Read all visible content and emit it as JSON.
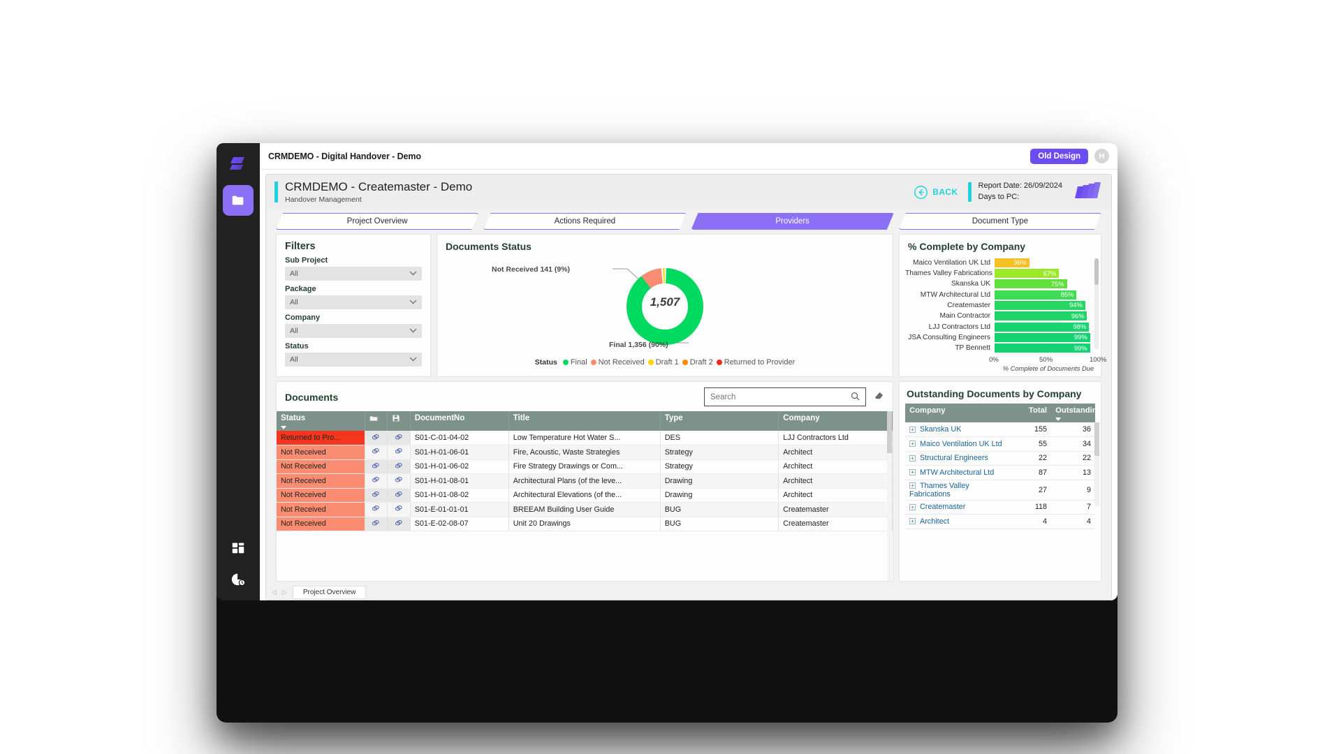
{
  "window": {
    "topbar_title": "CRMDEMO - Digital Handover - Demo",
    "old_design_label": "Old Design",
    "avatar_initial": "H"
  },
  "rail": {
    "logo_name": "layers-logo-icon",
    "items": [
      {
        "name": "folder-icon",
        "active": true
      },
      {
        "name": "dashboard-grid-icon",
        "active": false
      },
      {
        "name": "pie-clock-icon",
        "active": false
      }
    ]
  },
  "report": {
    "title": "CRMDEMO - Createmaster - Demo",
    "subtitle": "Handover Management",
    "back_label": "BACK",
    "report_date": "Report Date: 26/09/2024",
    "days_to_pc": "Days to PC:",
    "accent_color": "#1ED2E0",
    "brand_color": "#6C4CF1"
  },
  "tabs": [
    {
      "label": "Project Overview",
      "active": false
    },
    {
      "label": "Actions Required",
      "active": false
    },
    {
      "label": "Providers",
      "active": true
    },
    {
      "label": "Document Type",
      "active": false
    }
  ],
  "filters": {
    "title": "Filters",
    "fields": [
      {
        "label": "Sub Project",
        "value": "All"
      },
      {
        "label": "Package",
        "value": "All"
      },
      {
        "label": "Company",
        "value": "All"
      },
      {
        "label": "Status",
        "value": "All"
      }
    ]
  },
  "documents_status": {
    "title": "Documents Status",
    "center_total": "1,507",
    "label_not_received": "Not Received 141 (9%)",
    "label_final": "Final 1,356 (90%)",
    "legend_title": "Status",
    "legend": [
      {
        "label": "Final",
        "color": "#00D95F"
      },
      {
        "label": "Not Received",
        "color": "#FA8C72"
      },
      {
        "label": "Draft 1",
        "color": "#FFD400"
      },
      {
        "label": "Draft 2",
        "color": "#FF8C00"
      },
      {
        "label": "Returned to Provider",
        "color": "#F5291E"
      }
    ]
  },
  "complete_by_company": {
    "title": "% Complete by Company",
    "axis_caption": "% Complete of Documents Due"
  },
  "documents_panel": {
    "title": "Documents",
    "search_placeholder": "Search",
    "search_value": "",
    "columns": [
      "Status",
      "",
      "",
      "DocumentNo",
      "Title",
      "Type",
      "Company"
    ],
    "rows": [
      {
        "status": "Returned to Pro...",
        "status_color": "#F5361E",
        "no": "S01-C-01-04-02",
        "title": "Low Temperature Hot Water S...",
        "type": "DES",
        "company": "LJJ Contractors Ltd"
      },
      {
        "status": "Not Received",
        "status_color": "#FA8C72",
        "no": "S01-H-01-06-01",
        "title": "Fire, Acoustic, Waste Strategies",
        "type": "Strategy",
        "company": "Architect"
      },
      {
        "status": "Not Received",
        "status_color": "#FA8C72",
        "no": "S01-H-01-06-02",
        "title": "Fire Strategy Drawings or Com...",
        "type": "Strategy",
        "company": "Architect"
      },
      {
        "status": "Not Received",
        "status_color": "#FA8C72",
        "no": "S01-H-01-08-01",
        "title": "Architectural Plans (of the leve...",
        "type": "Drawing",
        "company": "Architect"
      },
      {
        "status": "Not Received",
        "status_color": "#FA8C72",
        "no": "S01-H-01-08-02",
        "title": "Architectural Elevations (of the...",
        "type": "Drawing",
        "company": "Architect"
      },
      {
        "status": "Not Received",
        "status_color": "#FA8C72",
        "no": "S01-E-01-01-01",
        "title": "BREEAM Building User Guide",
        "type": "BUG",
        "company": "Createmaster"
      },
      {
        "status": "Not Received",
        "status_color": "#FA8C72",
        "no": "S01-E-02-08-07",
        "title": "Unit 20 Drawings",
        "type": "BUG",
        "company": "Createmaster"
      }
    ]
  },
  "outstanding_panel": {
    "title": "Outstanding Documents by Company",
    "columns": [
      "Company",
      "Total",
      "Outstanding"
    ],
    "rows": [
      {
        "company": "Skanska UK",
        "total": "155",
        "outstanding": "36"
      },
      {
        "company": "Maico Ventilation UK Ltd",
        "total": "55",
        "outstanding": "34"
      },
      {
        "company": "Structural Engineers",
        "total": "22",
        "outstanding": "22"
      },
      {
        "company": "MTW Architectural Ltd",
        "total": "87",
        "outstanding": "13"
      },
      {
        "company": "Thames Valley Fabrications",
        "total": "27",
        "outstanding": "9"
      },
      {
        "company": "Createmaster",
        "total": "118",
        "outstanding": "7"
      },
      {
        "company": "Architect",
        "total": "4",
        "outstanding": "4"
      }
    ]
  },
  "pagetabs": {
    "prev": "◁",
    "next": "▷",
    "tabs": [
      {
        "label": "Project Overview"
      }
    ]
  },
  "chart_data": [
    {
      "type": "pie",
      "title": "Documents Status",
      "subtitle": "",
      "center_label": "1,507",
      "legend_position": "bottom",
      "labels": [
        "Final",
        "Not Received",
        "Draft 1",
        "Draft 2",
        "Returned to Provider"
      ],
      "values": [
        1356,
        141,
        6,
        2,
        2
      ],
      "percents": [
        90,
        9,
        0.4,
        0.1,
        0.1
      ],
      "colors": [
        "#00D95F",
        "#FA8C72",
        "#FFD400",
        "#FF8C00",
        "#F5291E"
      ],
      "annotations": [
        "Not Received 141 (9%)",
        "Final 1,356 (90%)"
      ]
    },
    {
      "type": "bar",
      "orientation": "horizontal",
      "title": "% Complete by Company",
      "xlabel": "% Complete of Documents Due",
      "ylabel": "",
      "xlim": [
        0,
        100
      ],
      "xticks": [
        0,
        50,
        100
      ],
      "xticklabels": [
        "0%",
        "50%",
        "100%"
      ],
      "grid": true,
      "categories": [
        "Maico Ventilation UK Ltd",
        "Thames Valley Fabrications",
        "Skanska UK",
        "MTW Architectural Ltd",
        "Createmaster",
        "Main Contractor",
        "LJJ Contractors Ltd",
        "JSA Consulting Engineers",
        "TP Bennett"
      ],
      "values": [
        36,
        67,
        75,
        85,
        94,
        96,
        98,
        99,
        99
      ],
      "data_labels": [
        "36%",
        "67%",
        "75%",
        "85%",
        "94%",
        "96%",
        "98%",
        "99%",
        "99%"
      ],
      "colors": [
        "#F5C024",
        "#9BE82B",
        "#5FE03A",
        "#3CDC54",
        "#26D762",
        "#1FD568",
        "#18D46E",
        "#12D272",
        "#12D272"
      ]
    },
    {
      "type": "table",
      "title": "Outstanding Documents by Company",
      "columns": [
        "Company",
        "Total",
        "Outstanding"
      ],
      "rows": [
        [
          "Skanska UK",
          155,
          36
        ],
        [
          "Maico Ventilation UK Ltd",
          55,
          34
        ],
        [
          "Structural Engineers",
          22,
          22
        ],
        [
          "MTW Architectural Ltd",
          87,
          13
        ],
        [
          "Thames Valley Fabrications",
          27,
          9
        ],
        [
          "Createmaster",
          118,
          7
        ],
        [
          "Architect",
          4,
          4
        ]
      ],
      "sort_column": "Outstanding",
      "sort_order": "desc"
    }
  ]
}
